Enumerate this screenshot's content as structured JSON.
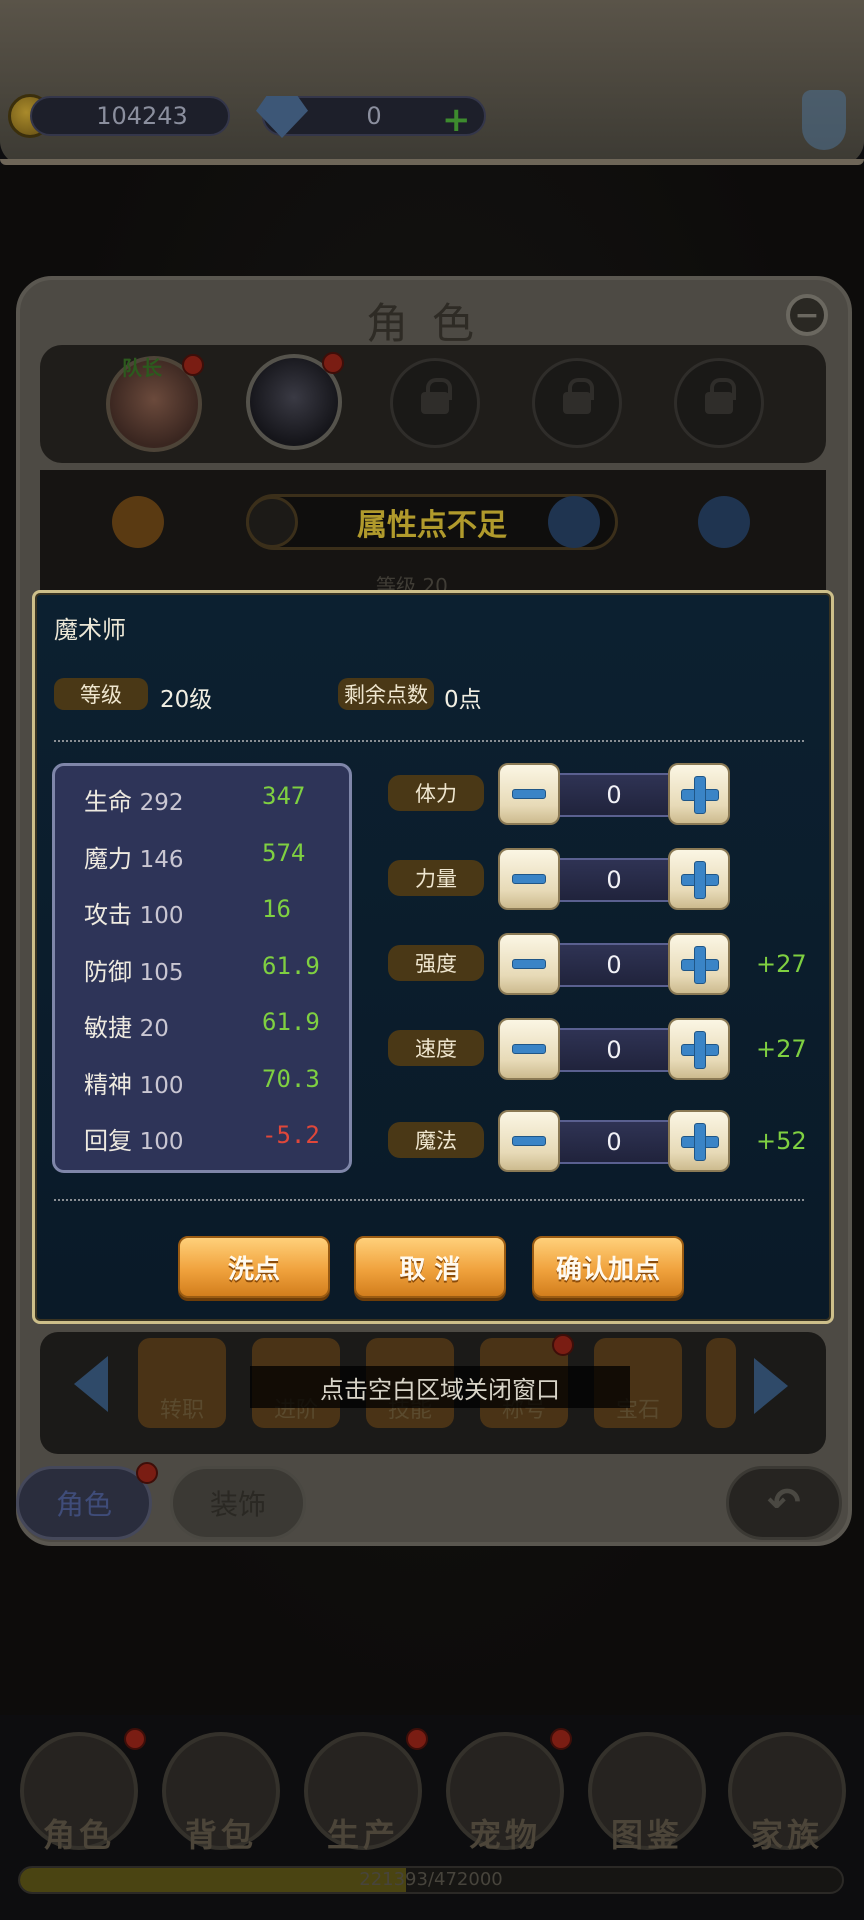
{
  "currency": {
    "gold": "104243",
    "gems": "0"
  },
  "panel": {
    "title": "角色",
    "leader_label": "队长"
  },
  "header_bar": {
    "status_text": "属性点不足",
    "level_peek": "等级 20"
  },
  "modal": {
    "job": "魔术师",
    "level_label": "等级",
    "level_value": "20级",
    "remaining_label": "剩余点数",
    "remaining_value": "0点",
    "stats": [
      {
        "name": "生命",
        "base": "292",
        "bonus": "347",
        "bonus_color": "#7fd041"
      },
      {
        "name": "魔力",
        "base": "146",
        "bonus": "574",
        "bonus_color": "#7fd041"
      },
      {
        "name": "攻击",
        "base": "100",
        "bonus": "16",
        "bonus_color": "#7fd041"
      },
      {
        "name": "防御",
        "base": "105",
        "bonus": "61.9",
        "bonus_color": "#7fd041"
      },
      {
        "name": "敏捷",
        "base": "20",
        "bonus": "61.9",
        "bonus_color": "#7fd041"
      },
      {
        "name": "精神",
        "base": "100",
        "bonus": "70.3",
        "bonus_color": "#7fd041"
      },
      {
        "name": "回复",
        "base": "100",
        "bonus": "-5.2",
        "bonus_color": "#e0473a"
      }
    ],
    "allocations": [
      {
        "label": "体力",
        "value": "0",
        "extra": ""
      },
      {
        "label": "力量",
        "value": "0",
        "extra": ""
      },
      {
        "label": "强度",
        "value": "0",
        "extra": "+27"
      },
      {
        "label": "速度",
        "value": "0",
        "extra": "+27"
      },
      {
        "label": "魔法",
        "value": "0",
        "extra": "+52"
      }
    ],
    "buttons": {
      "reset": "洗点",
      "cancel": "取 消",
      "confirm": "确认加点"
    }
  },
  "functions": [
    {
      "label": "转职"
    },
    {
      "label": "进阶"
    },
    {
      "label": "技能"
    },
    {
      "label": "称号"
    },
    {
      "label": "宝石"
    }
  ],
  "hint": "点击空白区域关闭窗口",
  "bottom_tabs": {
    "role": "角色",
    "decor": "装饰"
  },
  "nav": [
    {
      "label": "角色"
    },
    {
      "label": "背包"
    },
    {
      "label": "生产"
    },
    {
      "label": "宠物"
    },
    {
      "label": "图鉴"
    },
    {
      "label": "家族"
    }
  ],
  "xp": {
    "text": "221393/472000",
    "fraction": 0.469
  },
  "colors": {
    "accent_gold": "#cdbf8a",
    "button_orange": "#f0a23d",
    "bonus_green": "#7fd041",
    "bonus_red": "#e0473a"
  }
}
